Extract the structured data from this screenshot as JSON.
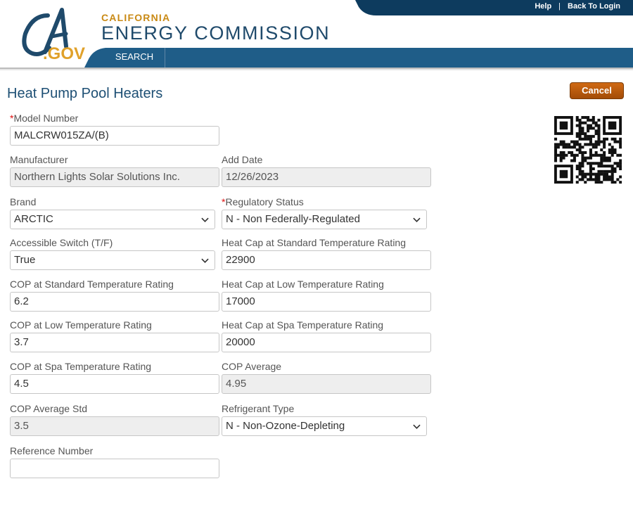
{
  "header": {
    "logo": {
      "ca": "CA",
      "gov": ".GOV"
    },
    "org_small": "CALIFORNIA",
    "org_big": "ENERGY COMMISSION",
    "links": {
      "help": "Help",
      "separator": "|",
      "back_to_login": "Back To Login"
    },
    "nav": {
      "search": "SEARCH"
    }
  },
  "page": {
    "title": "Heat Pump Pool Heaters",
    "cancel_label": "Cancel"
  },
  "form": {
    "model_number": {
      "label": "Model Number",
      "required": "*",
      "value": "MALCRW015ZA/(B)"
    },
    "manufacturer": {
      "label": "Manufacturer",
      "value": "Northern Lights Solar Solutions Inc."
    },
    "add_date": {
      "label": "Add Date",
      "value": "12/26/2023"
    },
    "brand": {
      "label": "Brand",
      "value": "ARCTIC"
    },
    "regulatory_status": {
      "label": "Regulatory Status",
      "required": "*",
      "value": "N - Non Federally-Regulated"
    },
    "accessible_switch": {
      "label": "Accessible Switch (T/F)",
      "value": "True"
    },
    "heat_cap_standard": {
      "label": "Heat Cap at Standard Temperature Rating",
      "value": "22900"
    },
    "cop_standard": {
      "label": "COP at Standard Temperature Rating",
      "value": "6.2"
    },
    "heat_cap_low": {
      "label": "Heat Cap at Low Temperature Rating",
      "value": "17000"
    },
    "cop_low": {
      "label": "COP at Low Temperature Rating",
      "value": "3.7"
    },
    "heat_cap_spa": {
      "label": "Heat Cap at Spa Temperature Rating",
      "value": "20000"
    },
    "cop_spa": {
      "label": "COP at Spa Temperature Rating",
      "value": "4.5"
    },
    "cop_average": {
      "label": "COP Average",
      "value": "4.95"
    },
    "cop_average_std": {
      "label": "COP Average Std",
      "value": "3.5"
    },
    "refrigerant_type": {
      "label": "Refrigerant Type",
      "value": "N - Non-Ozone-Depleting"
    },
    "reference_number": {
      "label": "Reference Number",
      "value": ""
    }
  },
  "icons": {
    "dropdown": "chevron-down-icon",
    "qr": "qr-code-icon"
  },
  "colors": {
    "header_navy": "#0d3b5e",
    "nav_blue": "#1f5d88",
    "title_blue": "#1d4f74",
    "cancel_orange": "#c0600f",
    "gold": "#c98a15",
    "required_red": "#dd1111",
    "readonly_gray": "#eeeeee"
  }
}
